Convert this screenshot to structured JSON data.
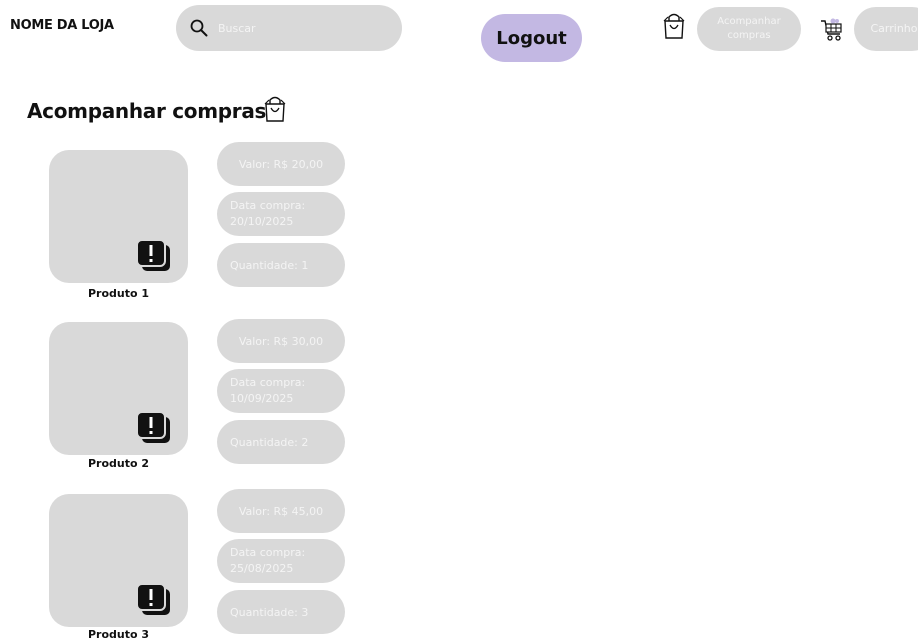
{
  "header": {
    "store_name": "NOME DA LOJA",
    "search_placeholder": "Buscar",
    "search_value": "",
    "logout_label": "Logout",
    "track_label": "Acompanhar\ncompras",
    "cart_label": "Carrinho"
  },
  "page": {
    "title": "Acompanhar compras:"
  },
  "icons": {
    "search": "search-icon",
    "bag": "shopping-bag-icon",
    "cart": "shopping-cart-icon",
    "alert": "alert-icon"
  },
  "colors": {
    "pill_bg": "#d9d9d9",
    "pill_text": "#f4f4f4",
    "logout_bg": "#c3b8e3"
  },
  "orders": [
    {
      "name": "Produto 1",
      "value": "Valor: R$ 20,00",
      "date_label": "Data compra:",
      "date": "20/10/2025",
      "quantity": "Quantidade: 1"
    },
    {
      "name": "Produto 2",
      "value": "Valor: R$ 30,00",
      "date_label": "Data compra:",
      "date": "10/09/2025",
      "quantity": "Quantidade: 2"
    },
    {
      "name": "Produto 3",
      "value": "Valor: R$ 45,00",
      "date_label": "Data compra:",
      "date": "25/08/2025",
      "quantity": "Quantidade: 3"
    }
  ]
}
